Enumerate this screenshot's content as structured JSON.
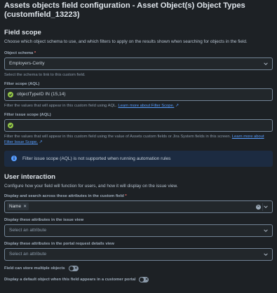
{
  "header": {
    "title": "Assets objects field configuration - Asset Object(s) Object Types (customfield_13223)"
  },
  "field_scope": {
    "heading": "Field scope",
    "description": "Choose which object schema to use, and which filters to apply on the results shown when searching for objects in the field.",
    "object_schema": {
      "label": "Object schema",
      "required_mark": "*",
      "value": "Employers-Cerity",
      "helper": "Select the schema to link to this custom field."
    },
    "filter_scope": {
      "label": "Filter scope (AQL)",
      "value": "objectTypeID IN (15,14)",
      "helper": "Filter the values that will appear in this custom field using AQL.",
      "link": "Learn more about Filter Scope."
    },
    "filter_issue_scope": {
      "label": "Filter issue scope (AQL)",
      "value": "",
      "helper": "Filter the values that will appear in this custom field using the value of Assets custom fields or Jira System fields in this screen.",
      "link": "Learn more about Filter Issue Scope."
    },
    "info_message": "Filter issue scope (AQL) is not supported when running automation rules"
  },
  "user_interaction": {
    "heading": "User interaction",
    "description": "Configure how your field will function for users, and how it will display on the issue view.",
    "display_search": {
      "label": "Display and search across these attributes in the custom field",
      "required_mark": "*",
      "tags": [
        "Name"
      ]
    },
    "issue_view": {
      "label": "Display these attributes in the issue view",
      "placeholder": "Select an attribute"
    },
    "portal_view": {
      "label": "Display these attributes in the portal request details view",
      "placeholder": "Select an attribute"
    },
    "multiple_objects": {
      "label": "Field can store multiple objects",
      "enabled": false
    },
    "default_object": {
      "label": "Display a default object when this field appears in a customer portal",
      "enabled": false
    }
  },
  "colors": {
    "background": "#1d2125",
    "link": "#579dff",
    "success": "#94c748",
    "info_bg": "#1c2b41",
    "required": "#f87168"
  },
  "icons": [
    "chevron-down-icon",
    "check-circle-icon",
    "info-icon",
    "external-link-icon",
    "clear-icon",
    "remove-tag-icon",
    "toggle-off-icon"
  ]
}
